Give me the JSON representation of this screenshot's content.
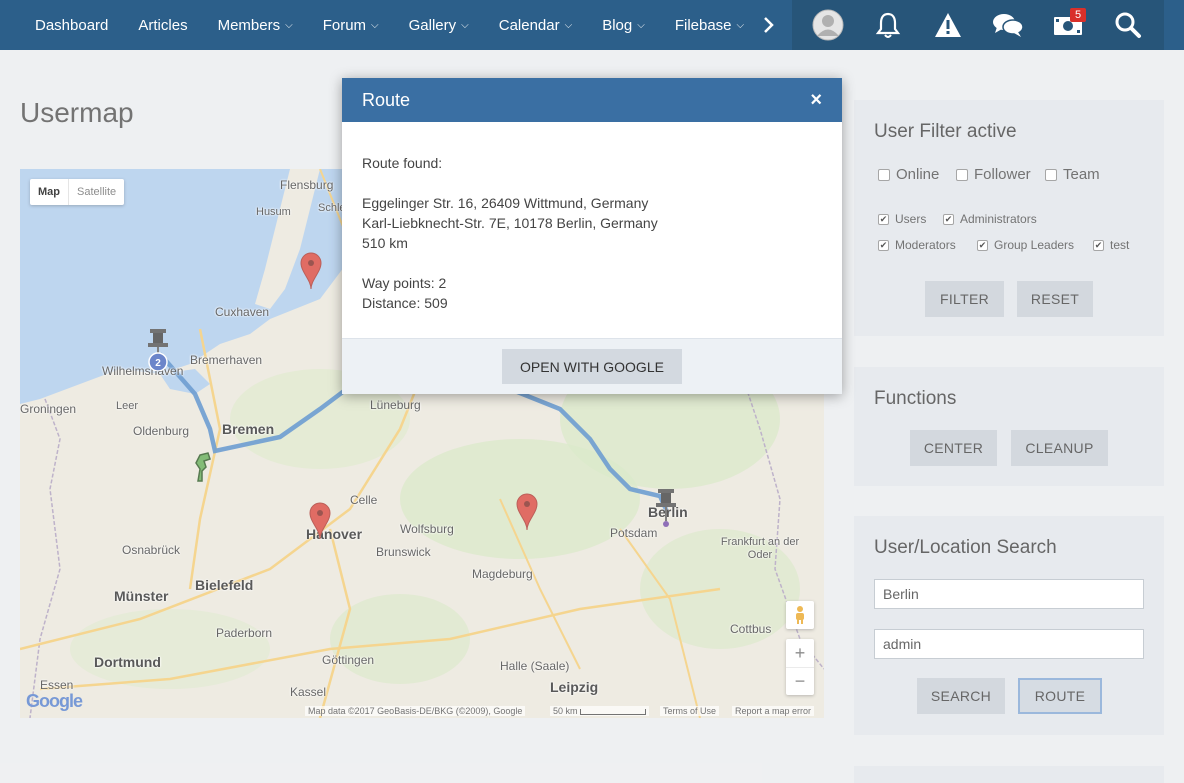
{
  "nav": {
    "items": [
      {
        "label": "Dashboard",
        "dropdown": false
      },
      {
        "label": "Articles",
        "dropdown": false
      },
      {
        "label": "Members",
        "dropdown": true
      },
      {
        "label": "Forum",
        "dropdown": true
      },
      {
        "label": "Gallery",
        "dropdown": true
      },
      {
        "label": "Calendar",
        "dropdown": true
      },
      {
        "label": "Blog",
        "dropdown": true
      },
      {
        "label": "Filebase",
        "dropdown": true
      }
    ],
    "more_icon": "chevron-right-icon",
    "user_icons": [
      "avatar",
      "bell-icon",
      "warning-icon",
      "chat-icon",
      "money-icon",
      "search-icon"
    ],
    "notification_badge": "5"
  },
  "page": {
    "title": "Usermap"
  },
  "map": {
    "type_buttons": {
      "map": "Map",
      "satellite": "Satellite"
    },
    "cities": [
      {
        "name": "Flensburg"
      },
      {
        "name": "Husum"
      },
      {
        "name": "Schleswig"
      },
      {
        "name": "Cuxhaven"
      },
      {
        "name": "Bremerhaven"
      },
      {
        "name": "Wilhelmshaven"
      },
      {
        "name": "Groningen"
      },
      {
        "name": "Leer"
      },
      {
        "name": "Oldenburg"
      },
      {
        "name": "Bremen"
      },
      {
        "name": "Lüneburg"
      },
      {
        "name": "Celle"
      },
      {
        "name": "Hanover"
      },
      {
        "name": "Wolfsburg"
      },
      {
        "name": "Brunswick"
      },
      {
        "name": "Osnabrück"
      },
      {
        "name": "Bielefeld"
      },
      {
        "name": "Münster"
      },
      {
        "name": "Paderborn"
      },
      {
        "name": "Dortmund"
      },
      {
        "name": "Göttingen"
      },
      {
        "name": "Essen"
      },
      {
        "name": "Kassel"
      },
      {
        "name": "Magdeburg"
      },
      {
        "name": "Halle (Saale)"
      },
      {
        "name": "Leipzig"
      },
      {
        "name": "Potsdam"
      },
      {
        "name": "Berlin"
      },
      {
        "name": "Frankfurt an der Oder"
      },
      {
        "name": "Cottbus"
      }
    ],
    "cluster_count": "2",
    "zoom_in": "+",
    "zoom_out": "−",
    "attribution": "Map data ©2017 GeoBasis-DE/BKG (©2009), Google",
    "scale": "50 km",
    "terms": "Terms of Use",
    "report": "Report a map error",
    "google_logo": "Google"
  },
  "dialog": {
    "title": "Route",
    "close": "×",
    "found": "Route found:",
    "from": "Eggelinger Str. 16, 26409 Wittmund, Germany",
    "to": "Karl-Liebknecht-Str. 7E, 10178 Berlin, Germany",
    "route_length": "510 km",
    "waypoints": "Way points: 2",
    "distance": "Distance: 509",
    "google_button": "OPEN WITH GOOGLE"
  },
  "filter": {
    "title": "User Filter active",
    "row1": [
      {
        "label": "Online",
        "checked": false
      },
      {
        "label": "Follower",
        "checked": false
      },
      {
        "label": "Team",
        "checked": false
      }
    ],
    "row2": [
      {
        "label": "Users",
        "checked": true
      },
      {
        "label": "Administrators",
        "checked": true
      }
    ],
    "row3": [
      {
        "label": "Moderators",
        "checked": true
      },
      {
        "label": "Group Leaders",
        "checked": true
      },
      {
        "label": "test",
        "checked": true
      }
    ],
    "filter_button": "FILTER",
    "reset_button": "RESET"
  },
  "functions": {
    "title": "Functions",
    "center_button": "CENTER",
    "cleanup_button": "CLEANUP"
  },
  "search": {
    "title": "User/Location Search",
    "location_value": "Berlin",
    "user_value": "admin",
    "search_button": "SEARCH",
    "route_button": "ROUTE"
  },
  "colors": {
    "nav_bg": "#2c5f8a",
    "dialog_header": "#3a6fa3",
    "route_line": "#3d7cc2",
    "marker_red": "#d63b30",
    "badge": "#d9302a"
  }
}
